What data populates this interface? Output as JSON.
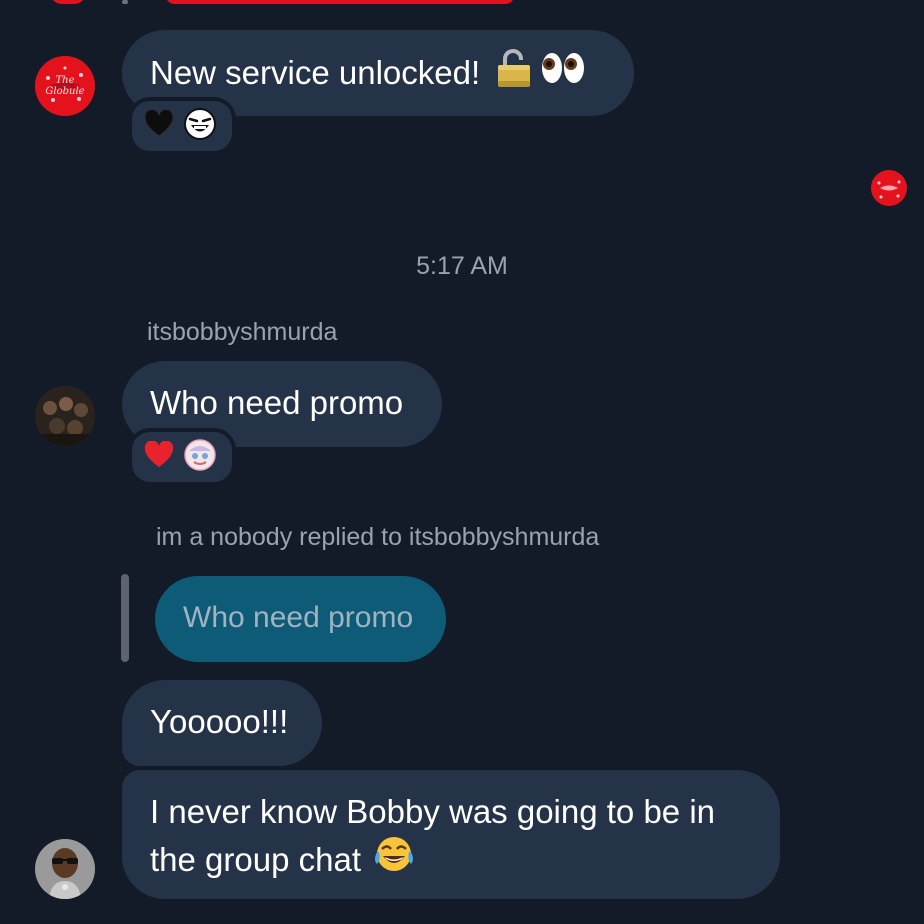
{
  "messages": {
    "unlock": {
      "text": "New service unlocked!",
      "reactions": [
        "black-heart",
        "laughing-face"
      ]
    },
    "timestamp": "5:17 AM",
    "bobby": {
      "sender": "itsbobbyshmurda",
      "text": "Who need promo",
      "reactions": [
        "red-heart",
        "sticker-face"
      ]
    },
    "reply_header": "im a nobody replied to itsbobbyshmurda",
    "quoted_text": "Who need promo",
    "yo": {
      "text": "Yooooo!!!"
    },
    "never": {
      "line1": "I never know Bobby was going to be in",
      "line2": "the group chat"
    }
  },
  "colors": {
    "background": "#141b28",
    "bubble": "#253349",
    "quoted_bubble": "#0e5b78",
    "meta_text": "#9aa2b0",
    "avatar_red": "#e0141e"
  }
}
